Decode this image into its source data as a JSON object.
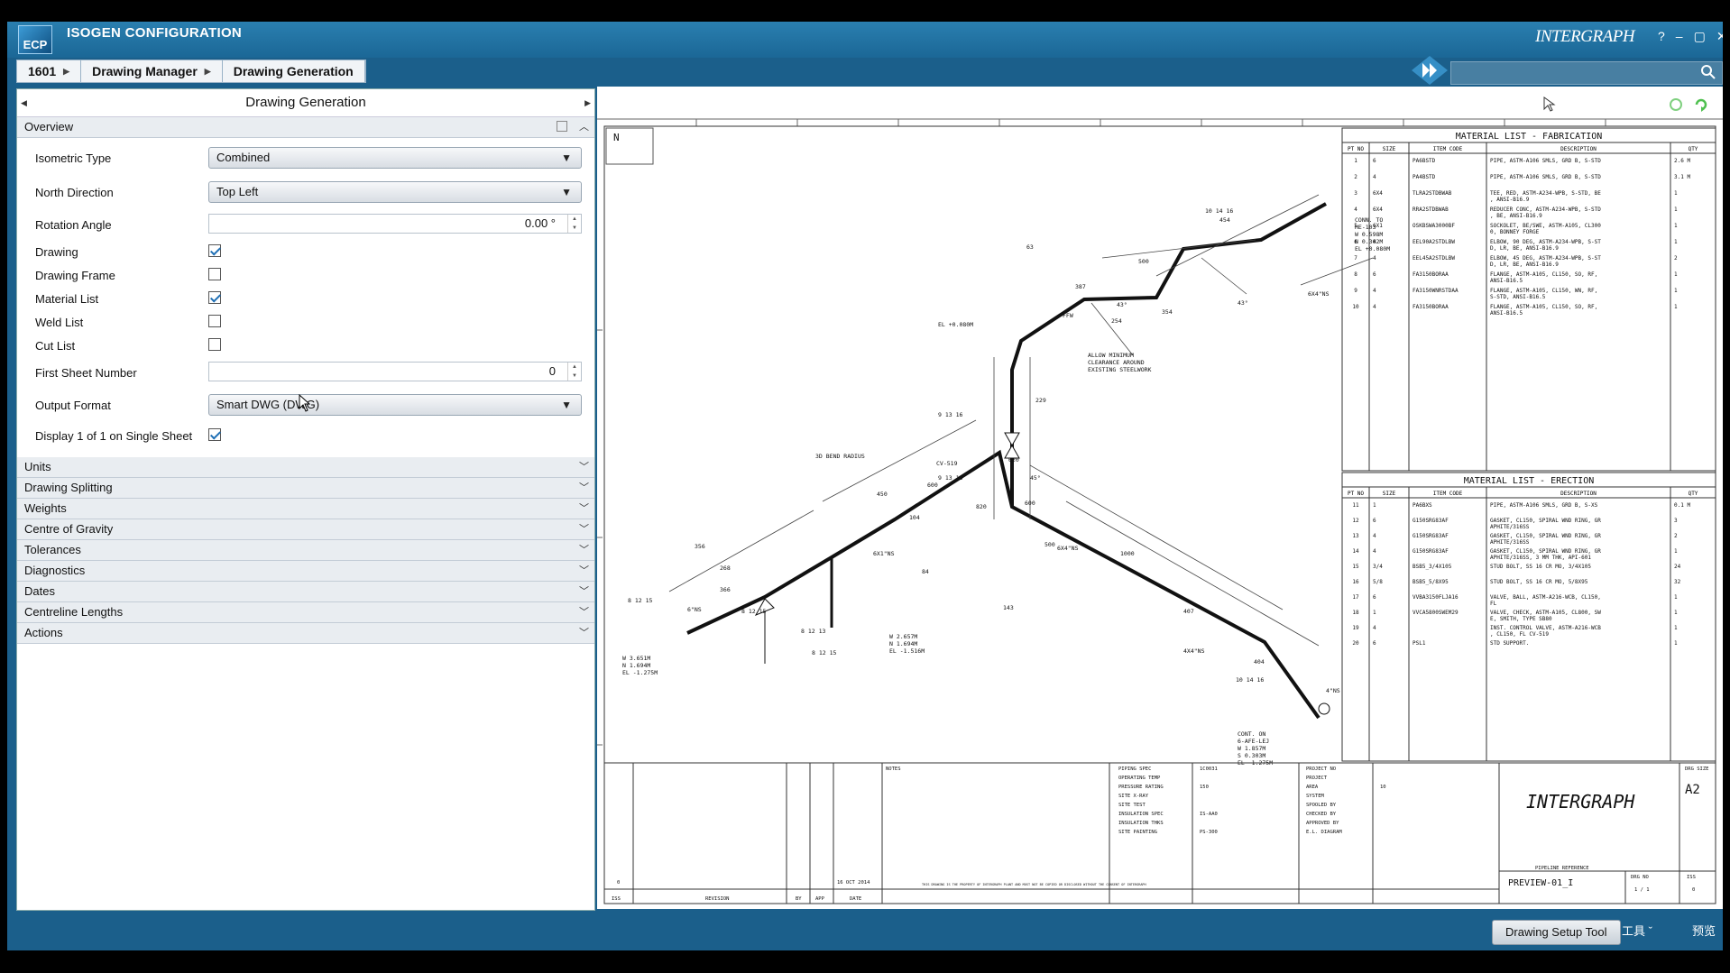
{
  "app": {
    "title": "ISOGEN CONFIGURATION",
    "logo": "ECP",
    "brand": "INTERGRAPH"
  },
  "window_controls": {
    "help": "?",
    "minimize": "–",
    "restore": "▢",
    "close": "✕"
  },
  "breadcrumb": [
    "1601",
    "Drawing Manager",
    "Drawing Generation"
  ],
  "panel": {
    "title": "Drawing Generation",
    "overview_label": "Overview",
    "fields": {
      "isometric_type": {
        "label": "Isometric Type",
        "value": "Combined"
      },
      "north_direction": {
        "label": "North Direction",
        "value": "Top Left"
      },
      "rotation_angle": {
        "label": "Rotation Angle",
        "value": "0.00 °"
      },
      "drawing": {
        "label": "Drawing",
        "checked": true
      },
      "drawing_frame": {
        "label": "Drawing Frame",
        "checked": false
      },
      "material_list": {
        "label": "Material List",
        "checked": true
      },
      "weld_list": {
        "label": "Weld List",
        "checked": false
      },
      "cut_list": {
        "label": "Cut List",
        "checked": false
      },
      "first_sheet_number": {
        "label": "First Sheet Number",
        "value": "0"
      },
      "output_format": {
        "label": "Output Format",
        "value": "Smart DWG (DWG)"
      },
      "display_1_of_1": {
        "label": "Display 1 of 1 on Single Sheet",
        "checked": true
      }
    },
    "sections": [
      "Units",
      "Drawing Splitting",
      "Weights",
      "Centre of Gravity",
      "Tolerances",
      "Diagnostics",
      "Dates",
      "Centreline Lengths",
      "Actions"
    ]
  },
  "drawing": {
    "north_label": "N",
    "ml_fab_title": "MATERIAL LIST - FABRICATION",
    "ml_erect_title": "MATERIAL LIST - ERECTION",
    "table_headers": [
      "PT NO",
      "SIZE",
      "ITEM CODE",
      "DESCRIPTION",
      "QTY"
    ],
    "fabrication_rows": [
      [
        "1",
        "6",
        "PA6BSTD",
        "PIPE, ASTM-A106 SMLS, GRD B, S-STD",
        "2.6 M"
      ],
      [
        "2",
        "4",
        "PA4BSTD",
        "PIPE, ASTM-A106 SMLS, GRD B, S-STD",
        "3.1 M"
      ],
      [
        "3",
        "6X4",
        "TLRA2STDBWAB",
        "TEE, RED, ASTM-A234-WPB, S-STD, BE, ANSI-B16.9",
        "1"
      ],
      [
        "4",
        "6X4",
        "RRA2STDBWAB",
        "REDUCER CONC, ASTM-A234-WPB, S-STD, BE, ANSI-B16.9",
        "1"
      ],
      [
        "5",
        "6X1",
        "OSKBSWA3000BF",
        "SOCKOLET, BE/SWE, ASTM-A105, CL3000, BONNEY FORGE",
        "1"
      ],
      [
        "6",
        "4",
        "EEL90A2STDLBW",
        "ELBOW, 90 DEG, ASTM-A234-WPB, S-STD, LR, BE, ANSI-B16.9",
        "1"
      ],
      [
        "7",
        "4",
        "EEL45A2STDLBW",
        "ELBOW, 45 DEG, ASTM-A234-WPB, S-STD, LR, BE, ANSI-B16.9",
        "2"
      ],
      [
        "8",
        "6",
        "FA3150BORAA",
        "FLANGE, ASTM-A105, CL150, SO, RF, ANSI-B16.5",
        "1"
      ],
      [
        "9",
        "4",
        "FA3150WNRSTDAA",
        "FLANGE, ASTM-A105, CL150, WN, RF, S-STD, ANSI-B16.5",
        "1"
      ],
      [
        "10",
        "4",
        "FA3150BORAA",
        "FLANGE, ASTM-A105, CL150, SO, RF, ANSI-B16.5",
        "1"
      ]
    ],
    "erection_rows": [
      [
        "11",
        "1",
        "PA6BXS",
        "PIPE, ASTM-A106 SMLS, GRD B, S-XS",
        "0.1 M"
      ],
      [
        "12",
        "6",
        "G150SRG83AF",
        "GASKET, CL150, SPIRAL WND RING, GRAPHITE/316SS",
        "3"
      ],
      [
        "13",
        "4",
        "G150SRG83AF",
        "GASKET, CL150, SPIRAL WND RING, GRAPHITE/316SS",
        "2"
      ],
      [
        "14",
        "4",
        "G150SRG83AF",
        "GASKET, CL150, SPIRAL WND RING, GRAPHITE/316SS, 3 MM THK, API-601",
        "1"
      ],
      [
        "15",
        "3/4",
        "BSB5_3/4X105",
        "STUD BOLT, SS 16 CR MO, 3/4X105",
        "24"
      ],
      [
        "16",
        "5/8",
        "BSB5_5/8X95",
        "STUD BOLT, SS 16 CR MO, 5/8X95",
        "32"
      ],
      [
        "17",
        "6",
        "VVBA3150FLJA16",
        "VALVE, BALL, ASTM-A216-WCB, CL150, FL",
        "1"
      ],
      [
        "18",
        "1",
        "VVCA5800SWEM29",
        "VALVE, CHECK, ASTM-A105, CL800, SWE, SMITH, TYPE SB80",
        "1"
      ],
      [
        "19",
        "4",
        "",
        "INST. CONTROL VALVE, ASTM-A216-WCB, CL150, FL CV-519",
        "1"
      ],
      [
        "20",
        "6",
        "PSL1",
        "STD SUPPORT.",
        "1"
      ]
    ],
    "iso_labels": {
      "conn_to": "CONN. TO",
      "conn_ref": "HE-103",
      "conn_w": "W 0.598M",
      "conn_n": "N 0.302M",
      "conn_el": "EL +0.080M",
      "allow": "ALLOW MINIMUM",
      "clearance": "CLEARANCE AROUND",
      "steelwork": "EXISTING STEELWORK",
      "bend": "3D BEND RADIUS",
      "cont_on": "CONT. ON",
      "cont_ref": "6-AFE-LEJ",
      "cont_w": "W 1.857M",
      "cont_s": "S 0.303M",
      "cont_el": "EL -1.275M",
      "left_w": "W 3.651M",
      "left_n": "N 1.694M",
      "left_el": "EL -1.275M",
      "mid_w": "W 2.657M",
      "mid_n": "N 1.694M",
      "mid_el": "EL -1.516M",
      "el_top": "EL +0.080M",
      "ffw": "FFW",
      "cv": "CV-519",
      "tag_a": "10 14 16",
      "tag_b": "9 13 16",
      "tag_c": "8 12 15",
      "tag_d": "10 14 16",
      "tag_e": "8 12 15",
      "tag_f": "8 12 15",
      "tag_g": "9 13 16",
      "tag_h": "820",
      "tag_i": "8 12 13",
      "tag_j": "4X4\"NS",
      "tag_k": "6X4\"NS",
      "tag_l": "6X1\"NS",
      "tag_m": "6X4\"NS",
      "tag_n": "6\"NS",
      "tag_o": "4\"NS",
      "deg_a": "43°",
      "deg_b": "43°",
      "deg_c": "45°",
      "dim_a": "500",
      "dim_b": "387",
      "dim_c": "356",
      "dim_d": "620",
      "dim_e": "600",
      "dim_f": "1000",
      "dim_g": "407",
      "dim_h": "404",
      "dim_i": "143",
      "dim_j": "600",
      "dim_k": "450",
      "dim_l": "366",
      "dim_m": "268",
      "dim_n": "229",
      "dim_o": "104",
      "dim_p": "84",
      "dim_q": "63",
      "dim_r": "254",
      "dim_s": "454",
      "dim_t": "354",
      "dim_u": "500"
    },
    "title_block": {
      "notes": "NOTES",
      "revision": "REVISION",
      "by": "BY",
      "app": "APP",
      "date_label": "DATE",
      "iss": "ISS",
      "rev_no": "0",
      "rev_date": "16 OCT 2014",
      "prop_text": "THIS DRAWING IS THE PROPERTY OF INTERGRAPH PLANT AND MUST NOT BE COPIED OR DISCLOSED WITHOUT THE CONSENT OF INTERGRAPH",
      "piping_spec": "PIPING SPEC",
      "piping_spec_val": "1C0031",
      "operating_temp": "OPERATING TEMP",
      "pressure_rating": "PRESSURE RATING",
      "pressure_val": "150",
      "site_xray": "SITE X-RAY",
      "site_test": "SITE TEST",
      "insulation_spec": "INSULATION SPEC",
      "insulation_val": "IS-AA0",
      "insulation_thk": "INSULATION THKS",
      "site_painting": "SITE PAINTING",
      "painting_val": "PS-300",
      "project_no": "PROJECT NO",
      "project": "PROJECT",
      "area": "AREA",
      "area_val": "10",
      "system": "SYSTEM",
      "spooled_by": "SPOOLED BY",
      "checked_by": "CHECKED BY",
      "approved_by": "APPROVED BY",
      "el_diagram": "E.L. DIAGRAM",
      "pipeline_ref": "PIPELINE REFERENCE",
      "preview": "PREVIEW-01_I",
      "drg_size": "DRG SIZE",
      "size_val": "A2",
      "drg_no": "DRG NO",
      "sheet": "1 / 1",
      "iss_label": "ISS",
      "iss_val": "0",
      "brand": "INTERGRAPH"
    }
  },
  "bottom": {
    "setup_button": "Drawing Setup Tool",
    "tools": "工具 ˇ",
    "preview": "预览"
  },
  "colors": {
    "accent": "#1b5f8b",
    "check": "#1e6fb5"
  }
}
